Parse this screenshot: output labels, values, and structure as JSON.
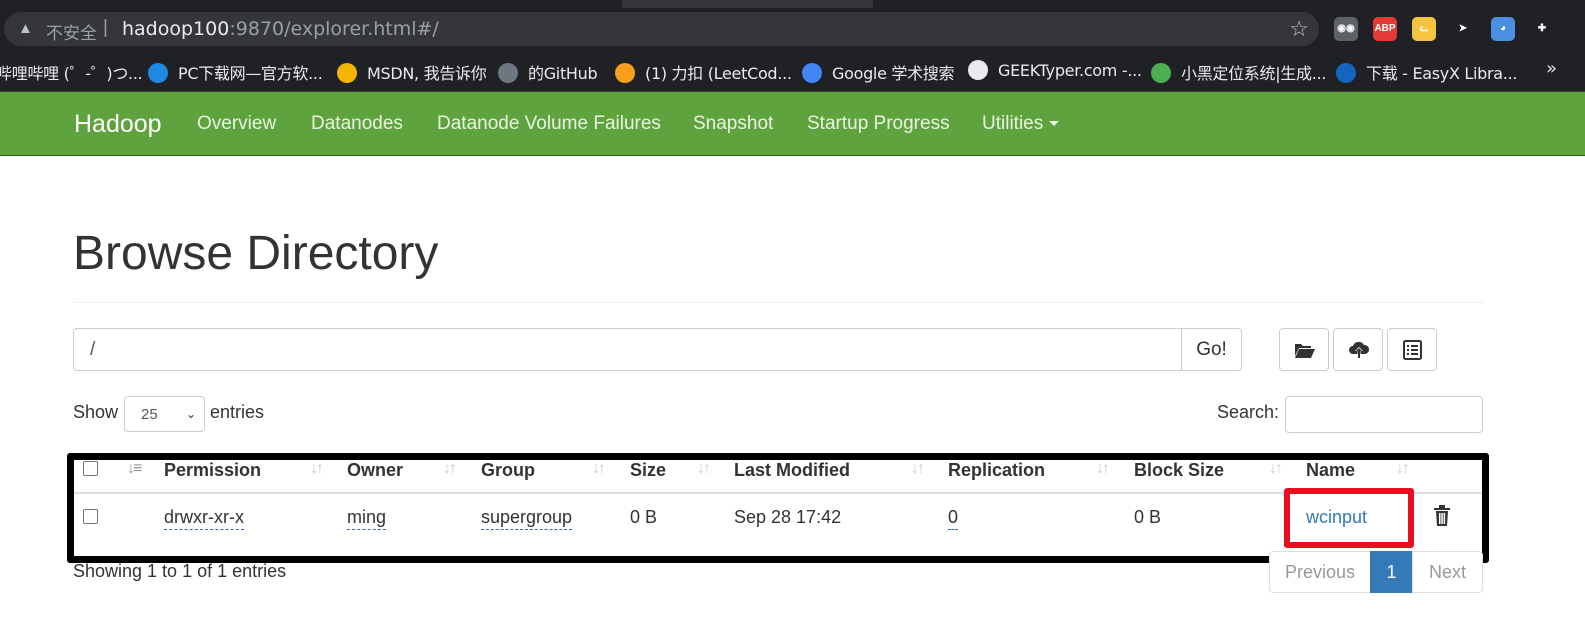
{
  "browser": {
    "security_label": "不安全",
    "url_host": "hadoop100",
    "url_rest": ":9870/explorer.html#/",
    "extensions": [
      {
        "name": "eyes-icon",
        "label": "◉◉",
        "color": "#5f6368"
      },
      {
        "name": "abp-icon",
        "label": "ABP",
        "color": "#e53935"
      },
      {
        "name": "cat-icon",
        "label": "ᓚ",
        "color": "#f5c542"
      },
      {
        "name": "cursor-icon",
        "label": "➤",
        "color": "#202124"
      },
      {
        "name": "bird-icon",
        "label": "◕",
        "color": "#4a90e2"
      },
      {
        "name": "puzzle-icon",
        "label": "✚",
        "color": "#202124"
      }
    ]
  },
  "bookmarks": [
    {
      "label": "哔哩哔哩 (゜-゜)つ...",
      "icon_color": "#202124"
    },
    {
      "label": "PC下载网—官方软...",
      "icon_color": "#1e88e5"
    },
    {
      "label": "MSDN, 我告诉你",
      "icon_color": "#f4b400"
    },
    {
      "label": "的GitHub",
      "icon_color": "#6e7681"
    },
    {
      "label": "(1) 力扣 (LeetCod...",
      "icon_color": "#f89f1b"
    },
    {
      "label": "Google 学术搜索",
      "icon_color": "#4285f4"
    },
    {
      "label": "GEEKTyper.com -...",
      "icon_color": "#e8eaed"
    },
    {
      "label": "小黑定位系统|生成...",
      "icon_color": "#4caf50"
    },
    {
      "label": "下载 - EasyX Libra...",
      "icon_color": "#1565c0"
    }
  ],
  "bookmarks_overflow": "»",
  "nav": {
    "brand": "Hadoop",
    "items": [
      "Overview",
      "Datanodes",
      "Datanode Volume Failures",
      "Snapshot",
      "Startup Progress",
      "Utilities"
    ]
  },
  "page": {
    "title": "Browse Directory",
    "directory_value": "/",
    "go_label": "Go!",
    "show_label": "Show",
    "entries_label": "entries",
    "page_size": "25",
    "search_label": "Search:",
    "info": "Showing 1 to 1 of 1 entries"
  },
  "table": {
    "headers": [
      "Permission",
      "Owner",
      "Group",
      "Size",
      "Last Modified",
      "Replication",
      "Block Size",
      "Name"
    ],
    "rows": [
      {
        "permission": "drwxr-xr-x",
        "owner": "ming",
        "group": "supergroup",
        "size": "0 B",
        "last_modified": "Sep 28 17:42",
        "replication": "0",
        "block_size": "0 B",
        "name": "wcinput"
      }
    ]
  },
  "pagination": {
    "previous": "Previous",
    "current": "1",
    "next": "Next",
    "active_color": "#337ab7"
  },
  "colors": {
    "navbar": "#5fa33e",
    "highlight_box": "#e8101f",
    "link": "#337ab7"
  }
}
